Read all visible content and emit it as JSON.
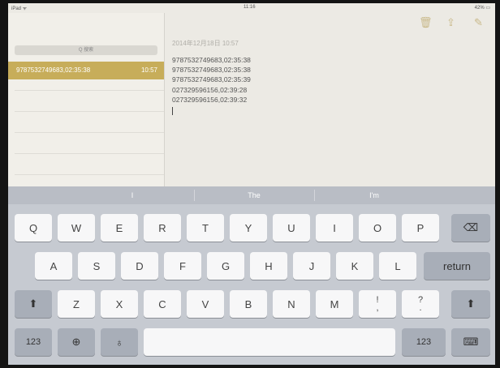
{
  "status_bar": {
    "device": "iPad ᯤ",
    "time": "11:16",
    "battery": "42% ▭"
  },
  "sidebar": {
    "search_placeholder": "Q 搜索",
    "notes": [
      {
        "title": "9787532749683,02:35:38",
        "time": "10:57"
      }
    ]
  },
  "detail": {
    "icons": [
      "trash-icon",
      "share-icon",
      "compose-icon"
    ],
    "date": "2014年12月18日 10:57",
    "lines": [
      "9787532749683,02:35:38",
      "9787532749683,02:35:38",
      "9787532749683,02:35:39",
      "027329596156,02:39:28",
      "027329596156,02:39:32"
    ]
  },
  "suggestions": [
    "I",
    "The",
    "I'm"
  ],
  "keyboard": {
    "row1": [
      "Q",
      "W",
      "E",
      "R",
      "T",
      "Y",
      "U",
      "I",
      "O",
      "P"
    ],
    "row2": [
      "A",
      "S",
      "D",
      "F",
      "G",
      "H",
      "J",
      "K",
      "L"
    ],
    "row3": [
      "Z",
      "X",
      "C",
      "V",
      "B",
      "N",
      "M"
    ],
    "punct1": "!\n,",
    "punct2": "?\n.",
    "return_label": "return",
    "numbers_label": "123"
  }
}
